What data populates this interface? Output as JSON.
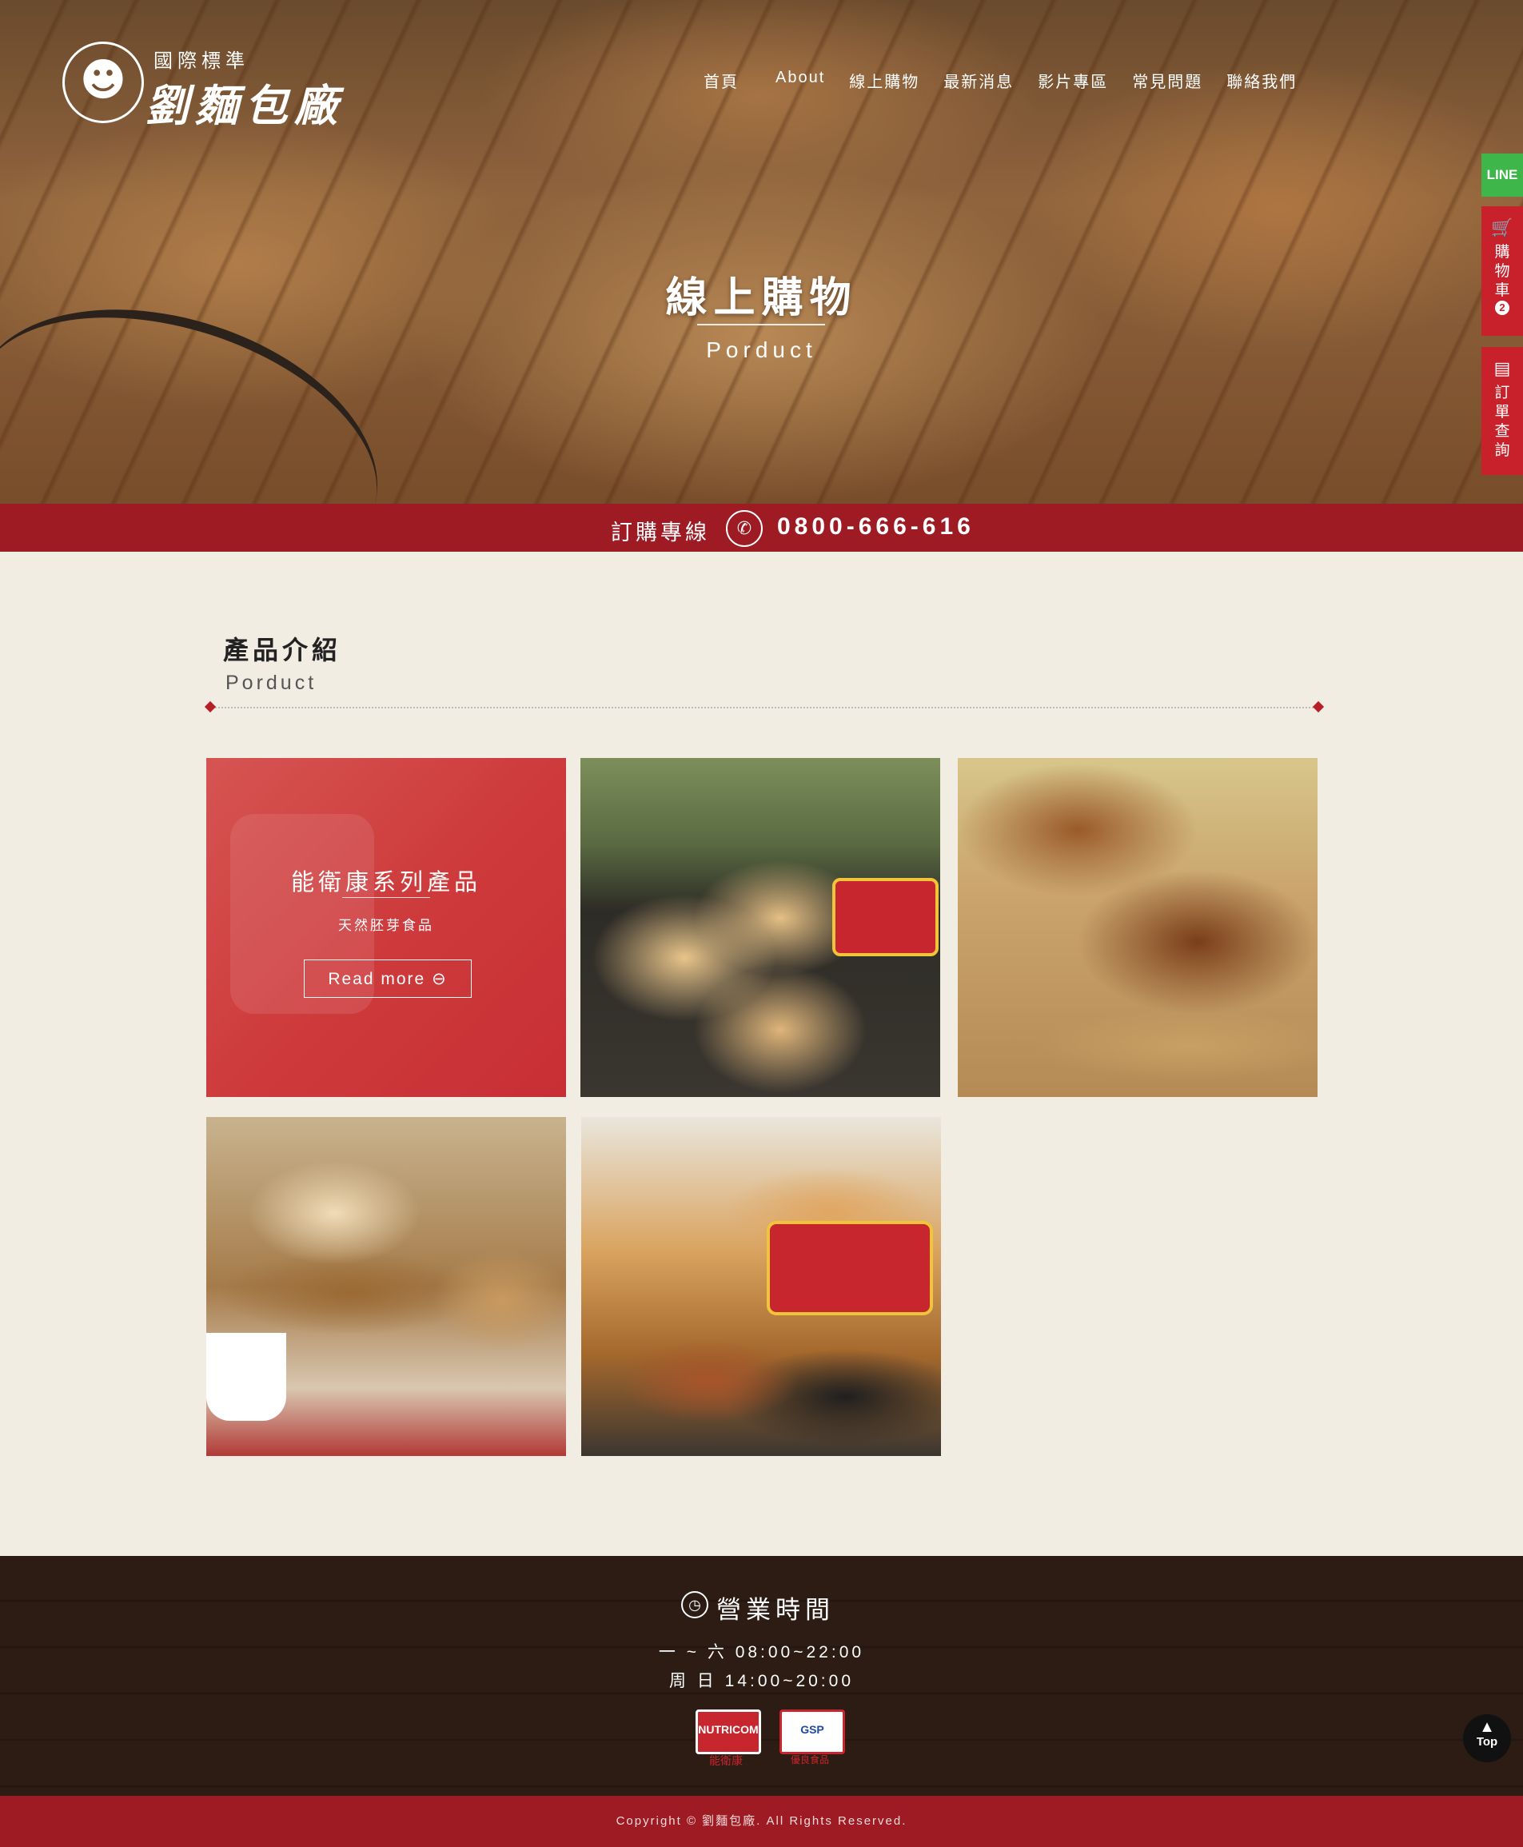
{
  "header": {
    "logo_icon": "lion-face",
    "logo_tagline": "國際標準",
    "logo_brand": "劉麵包廠",
    "nav": [
      "首頁",
      "About",
      "線上購物",
      "最新消息",
      "影片專區",
      "常見問題",
      "聯絡我們"
    ]
  },
  "hero": {
    "title": "線上購物",
    "subtitle": "Porduct"
  },
  "side": {
    "line_label": "LINE",
    "cart_label": "購物車",
    "cart_count": "2",
    "order_label": "訂單查詢"
  },
  "phone": {
    "label": "訂購專線",
    "number": "0800-666-616",
    "icon": "phone-icon"
  },
  "section": {
    "title": "產品介紹",
    "subtitle": "Porduct"
  },
  "products": [
    {
      "title": "能衛康系列產品",
      "subtitle": "天然胚芽食品",
      "button": "Read more",
      "button_icon": "arrow-circle-right"
    },
    {
      "name": "germ-crackers"
    },
    {
      "name": "walnut-cake"
    },
    {
      "name": "toast-bread"
    },
    {
      "name": "red-bean-cake"
    }
  ],
  "footer": {
    "title": "營業時間",
    "hours": [
      "一 ~ 六  08:00~22:00",
      "周    日  14:00~20:00"
    ],
    "logo1": "NUTRICOM",
    "logo1_caption": "能衛康",
    "logo2": "GSP",
    "logo2_caption": "優良食品",
    "copyright": "Copyright © 劉麵包廠. All Rights Reserved."
  },
  "top_button": "Top",
  "colors": {
    "brand_red": "#9e1b24",
    "line_green": "#3fb64a",
    "cart_red": "#c8212b"
  }
}
